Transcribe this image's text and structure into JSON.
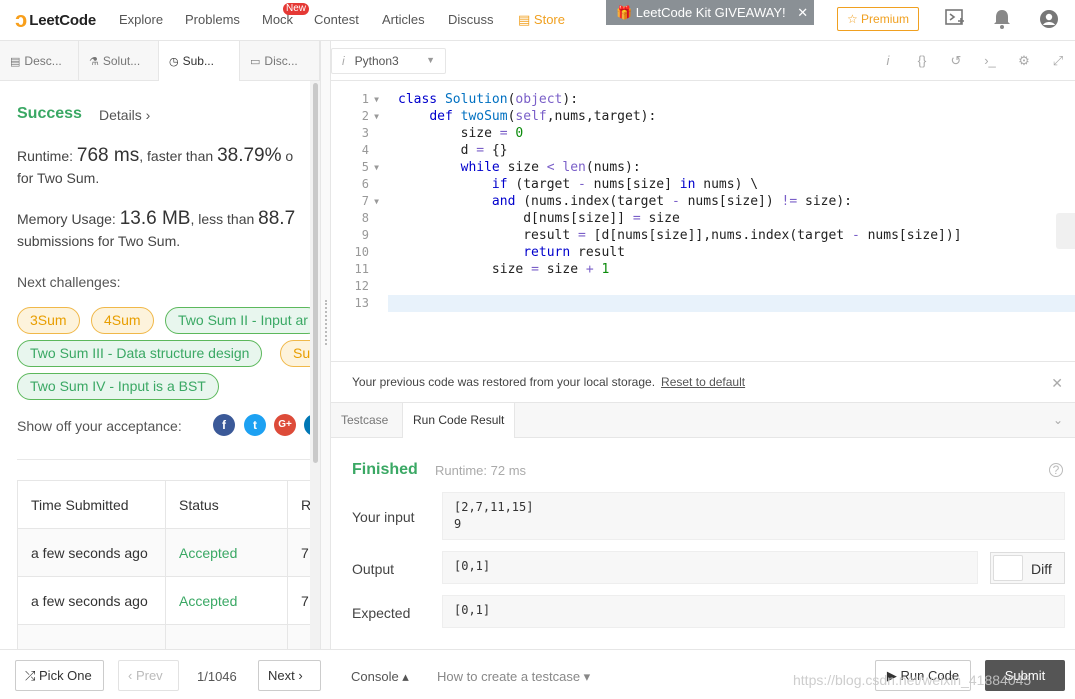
{
  "nav": {
    "logo_text": "LeetCode",
    "items": [
      {
        "label": "Explore"
      },
      {
        "label": "Problems"
      },
      {
        "label": "Mock"
      },
      {
        "label": "Contest"
      },
      {
        "label": "Articles"
      },
      {
        "label": "Discuss"
      },
      {
        "label": "Store"
      }
    ],
    "mock_badge": "New",
    "giveaway": "🎁 LeetCode Kit GIVEAWAY!",
    "giveaway_close": "✕",
    "premium": "☆ Premium"
  },
  "left_tabs": [
    {
      "label": "Desc...",
      "icon": "description-icon"
    },
    {
      "label": "Solut...",
      "icon": "flask-icon"
    },
    {
      "label": "Sub...",
      "icon": "clock-icon"
    },
    {
      "label": "Disc...",
      "icon": "discuss-icon"
    }
  ],
  "result": {
    "status": "Success",
    "details": "Details ›",
    "runtime_label": "Runtime: ",
    "runtime_value": "768 ms",
    "runtime_suffix": ", faster than ",
    "runtime_pct": "38.79%",
    "runtime_tail": " o",
    "runtime_line2": "for Two Sum.",
    "memory_label": "Memory Usage: ",
    "memory_value": "13.6 MB",
    "memory_suffix": ", less than ",
    "memory_pct": "88.7",
    "memory_line2": "submissions for Two Sum.",
    "next_challenges": "Next challenges:",
    "challenges": [
      {
        "label": "3Sum",
        "level": "easy"
      },
      {
        "label": "4Sum",
        "level": "easy"
      },
      {
        "label": "Two Sum II - Input ar",
        "level": "med"
      },
      {
        "label": "Two Sum III - Data structure design",
        "level": "med"
      },
      {
        "label": "Su",
        "level": "easy"
      },
      {
        "label": "Two Sum IV - Input is a BST",
        "level": "med"
      }
    ],
    "share_label": "Show off your acceptance:",
    "social": [
      {
        "label": "f",
        "color": "#3b5998"
      },
      {
        "label": "t",
        "color": "#1da1f2"
      },
      {
        "label": "G+",
        "color": "#dd4b39"
      },
      {
        "label": "",
        "color": "#0077b5"
      }
    ]
  },
  "submissions": {
    "headers": [
      "Time Submitted",
      "Status",
      "R"
    ],
    "rows": [
      [
        "a few seconds ago",
        "Accepted",
        "7"
      ],
      [
        "a few seconds ago",
        "Accepted",
        "7"
      ]
    ]
  },
  "editor": {
    "language": "Python3",
    "line_numbers": [
      "1",
      "2",
      "3",
      "4",
      "5",
      "6",
      "7",
      "8",
      "9",
      "10",
      "11",
      "12",
      "13"
    ],
    "folds": [
      1,
      2,
      5,
      7
    ],
    "lines": [
      "class Solution(object):",
      "    def twoSum(self,nums,target):",
      "        size = 0",
      "        d = {}",
      "        while size < len(nums):",
      "            if (target - nums[size] in nums) \\",
      "            and (nums.index(target - nums[size]) != size):",
      "                d[nums[size]] = size",
      "                result = [d[nums[size]],nums.index(target - nums[size])]",
      "                return result",
      "            size = size + 1",
      "",
      ""
    ]
  },
  "restore": {
    "message": "Your previous code was restored from your local storage.",
    "reset": "Reset to default",
    "close": "✕"
  },
  "result_tabs": [
    "Testcase",
    "Run Code Result"
  ],
  "run_result": {
    "status": "Finished",
    "runtime": "Runtime: 72 ms",
    "help": "?",
    "input_label": "Your input",
    "input_value": "[2,7,11,15]\n9",
    "output_label": "Output",
    "output_value": "[0,1]",
    "expected_label": "Expected",
    "expected_value": "[0,1]",
    "diff_label": "Diff"
  },
  "bottom": {
    "pick_one": "⤮ Pick One",
    "prev": "‹ Prev",
    "page": "1/1046",
    "next": "Next ›",
    "console": "Console ▴",
    "howto": "How to create a testcase ▾",
    "run_code": "▶ Run Code",
    "submit": "Submit",
    "watermark": "https://blog.csdn.net/weixin_41884045"
  }
}
